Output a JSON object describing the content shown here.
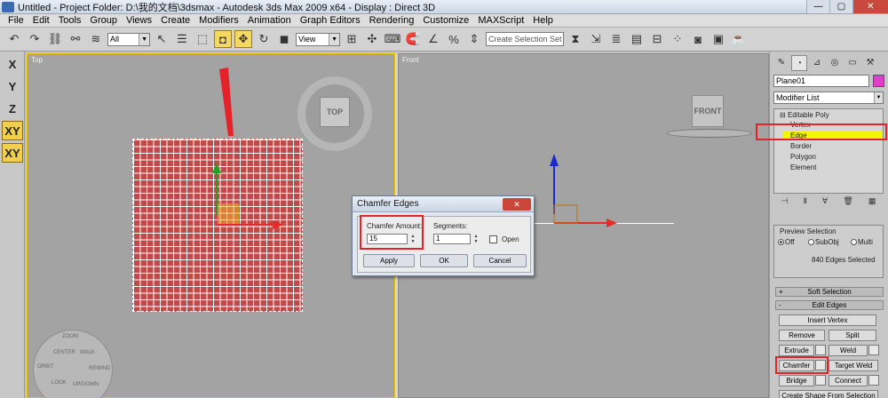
{
  "titlebar": {
    "title": "Untitled    - Project Folder: D:\\我的文档\\3dsmax    - Autodesk 3ds Max  2009 x64        - Display : Direct 3D",
    "minimize": "—",
    "maximize": "▢",
    "close": "✕"
  },
  "menu": [
    "File",
    "Edit",
    "Tools",
    "Group",
    "Views",
    "Create",
    "Modifiers",
    "Animation",
    "Graph Editors",
    "Rendering",
    "Customize",
    "MAXScript",
    "Help"
  ],
  "toolbar": {
    "selection_filter": "All",
    "ref_coord": "View",
    "named_selection_placeholder": "Create Selection Set"
  },
  "axis_constraints": [
    "X",
    "Y",
    "Z",
    "XY",
    "XY"
  ],
  "viewports": {
    "top_label": "Top",
    "front_label": "Front",
    "top_cube": "TOP",
    "front_cube": "FRONT",
    "wheel": [
      "ZOOM",
      "ORBIT",
      "CENTER",
      "WALK",
      "REWIND",
      "LOOK",
      "UP/DOWN"
    ]
  },
  "dialog": {
    "title": "Chamfer Edges",
    "close": "✕",
    "amount_label": "Chamfer Amount:",
    "amount_value": "15",
    "segments_label": "Segments:",
    "segments_value": "1",
    "open_label": "Open",
    "apply": "Apply",
    "ok": "OK",
    "cancel": "Cancel"
  },
  "command_panel": {
    "object_name": "Plane01",
    "object_color": "#e040c8",
    "modifier_list": "Modifier List",
    "stack": {
      "root": "Editable Poly",
      "items": [
        "Vertex",
        "Edge",
        "Border",
        "Polygon",
        "Element"
      ],
      "selected": "Edge"
    },
    "preview_selection": {
      "title": "Preview Selection",
      "off": "Off",
      "subobj": "SubObj",
      "multi": "Multi",
      "status": "840 Edges Selected"
    },
    "soft_selection": "Soft Selection",
    "edit_edges": {
      "title": "Edit Edges",
      "insert_vertex": "Insert Vertex",
      "remove": "Remove",
      "split": "Split",
      "extrude": "Extrude",
      "weld": "Weld",
      "chamfer": "Chamfer",
      "target_weld": "Target Weld",
      "bridge": "Bridge",
      "connect": "Connect",
      "create_shape": "Create Shape From Selection"
    }
  }
}
